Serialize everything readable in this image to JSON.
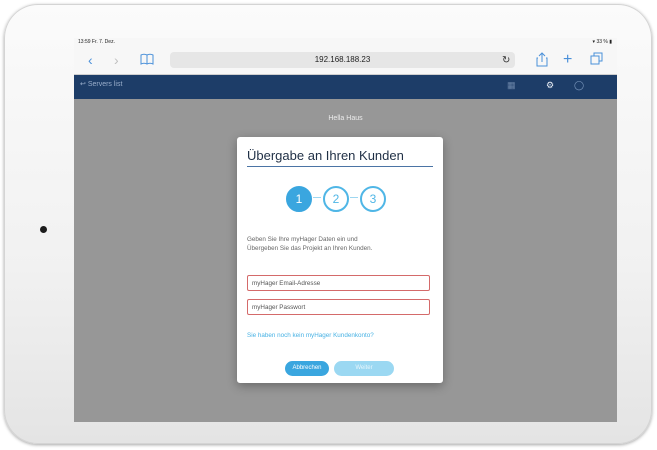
{
  "status_bar": {
    "time": "13:59",
    "date": "Fr. 7. Dez.",
    "battery": "33 %"
  },
  "browser": {
    "back_icon": "chevron-left-icon",
    "forward_icon": "chevron-right-icon",
    "bookmarks_icon": "book-icon",
    "url": "192.168.188.23",
    "reload_icon": "reload-icon",
    "share_icon": "share-icon",
    "new_tab_icon": "plus-icon",
    "tabs_icon": "tabs-icon"
  },
  "app_bar": {
    "servers_label": "Servers list",
    "color": "#1d3d68",
    "icons": [
      "grid-icon",
      "settings-icon",
      "user-icon"
    ]
  },
  "page": {
    "title": "Hella Haus"
  },
  "modal": {
    "title": "Übergabe an Ihren Kunden",
    "steps": [
      {
        "label": "1",
        "active": true
      },
      {
        "label": "2",
        "active": false
      },
      {
        "label": "3",
        "active": false
      }
    ],
    "description_line1": "Geben Sie Ihre myHager Daten ein und",
    "description_line2": "Übergeben Sie das Projekt an Ihren Kunden.",
    "email_placeholder": "myHager Email-Adresse",
    "password_placeholder": "myHager Passwort",
    "account_link": "Sie haben noch kein myHager Kundenkonto?",
    "cancel_label": "Abbrechen",
    "next_label": "Weiter",
    "accent_color": "#3aa6df",
    "error_border_color": "#d46a6a"
  }
}
